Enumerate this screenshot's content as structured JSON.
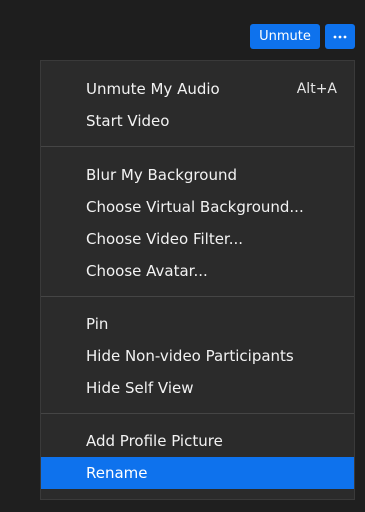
{
  "toolbar": {
    "unmute_label": "Unmute",
    "more_icon": "more-options-icon"
  },
  "menu": {
    "sections": [
      {
        "items": [
          {
            "label": "Unmute My Audio",
            "shortcut": "Alt+A"
          },
          {
            "label": "Start Video"
          }
        ]
      },
      {
        "items": [
          {
            "label": "Blur My Background"
          },
          {
            "label": "Choose Virtual Background..."
          },
          {
            "label": "Choose Video Filter..."
          },
          {
            "label": "Choose Avatar..."
          }
        ]
      },
      {
        "items": [
          {
            "label": "Pin"
          },
          {
            "label": "Hide Non-video Participants"
          },
          {
            "label": "Hide Self View"
          }
        ]
      },
      {
        "items": [
          {
            "label": "Add Profile Picture"
          },
          {
            "label": "Rename",
            "selected": true
          }
        ]
      }
    ]
  },
  "colors": {
    "accent": "#0e72ed",
    "menu_bg": "#2b2b2b",
    "background": "#1e1e1e"
  }
}
